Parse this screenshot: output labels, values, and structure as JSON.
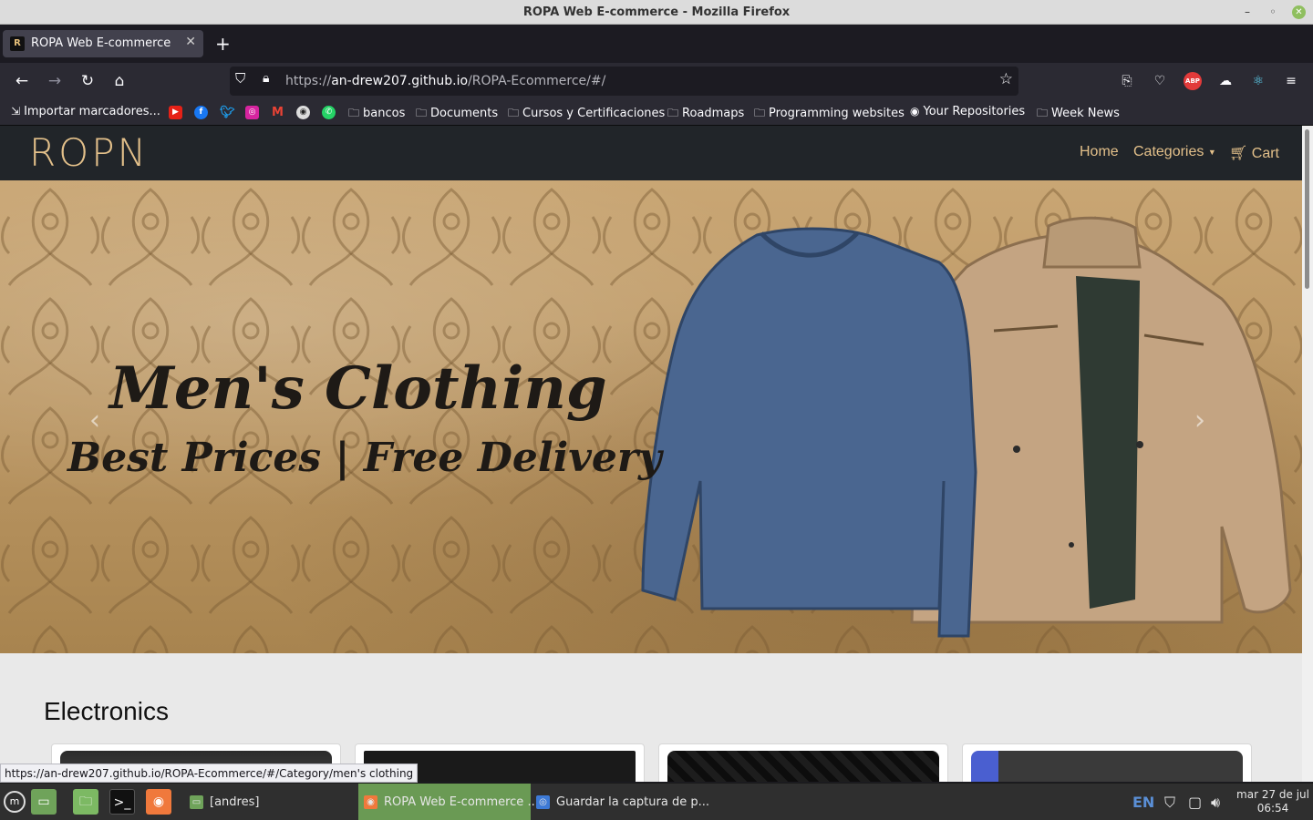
{
  "window": {
    "title": "ROPA Web E-commerce - Mozilla Firefox"
  },
  "tabs": [
    {
      "label": "ROPA Web E-commerce",
      "favicon": "R"
    }
  ],
  "urlbar": {
    "url_prefix": "https://",
    "url_host": "an-drew207.github.io",
    "url_path": "/ROPA-Ecommerce/#/"
  },
  "bookmarks": [
    {
      "label": "Importar marcadores...",
      "icon": "import-icon"
    },
    {
      "label": "bancos",
      "icon": "folder-icon"
    },
    {
      "label": "Documents",
      "icon": "folder-icon"
    },
    {
      "label": "Cursos y Certificaciones",
      "icon": "folder-icon"
    },
    {
      "label": "Roadmaps",
      "icon": "folder-icon"
    },
    {
      "label": "Programming websites",
      "icon": "folder-icon"
    },
    {
      "label": "Your Repositories",
      "icon": "github-icon"
    },
    {
      "label": "Week News",
      "icon": "folder-icon"
    }
  ],
  "site": {
    "logo": "ROPN",
    "nav": {
      "home": "Home",
      "categories": "Categories",
      "cart": "Cart"
    },
    "hero": {
      "title": "Men's Clothing",
      "subtitle": "Best Prices | Free Delivery"
    },
    "section_title": "Electronics",
    "accent_color": "#e3c08a"
  },
  "status_bar": {
    "link_preview": "https://an-drew207.github.io/ROPA-Ecommerce/#/Category/men's clothing"
  },
  "taskbar": {
    "tasks": [
      {
        "label": "[andres]"
      },
      {
        "label": "ROPA Web E-commerce ..."
      },
      {
        "label": "Guardar la captura de p..."
      }
    ],
    "keyboard_layout": "EN",
    "clock_date": "mar 27 de jul",
    "clock_time": "06:54"
  }
}
